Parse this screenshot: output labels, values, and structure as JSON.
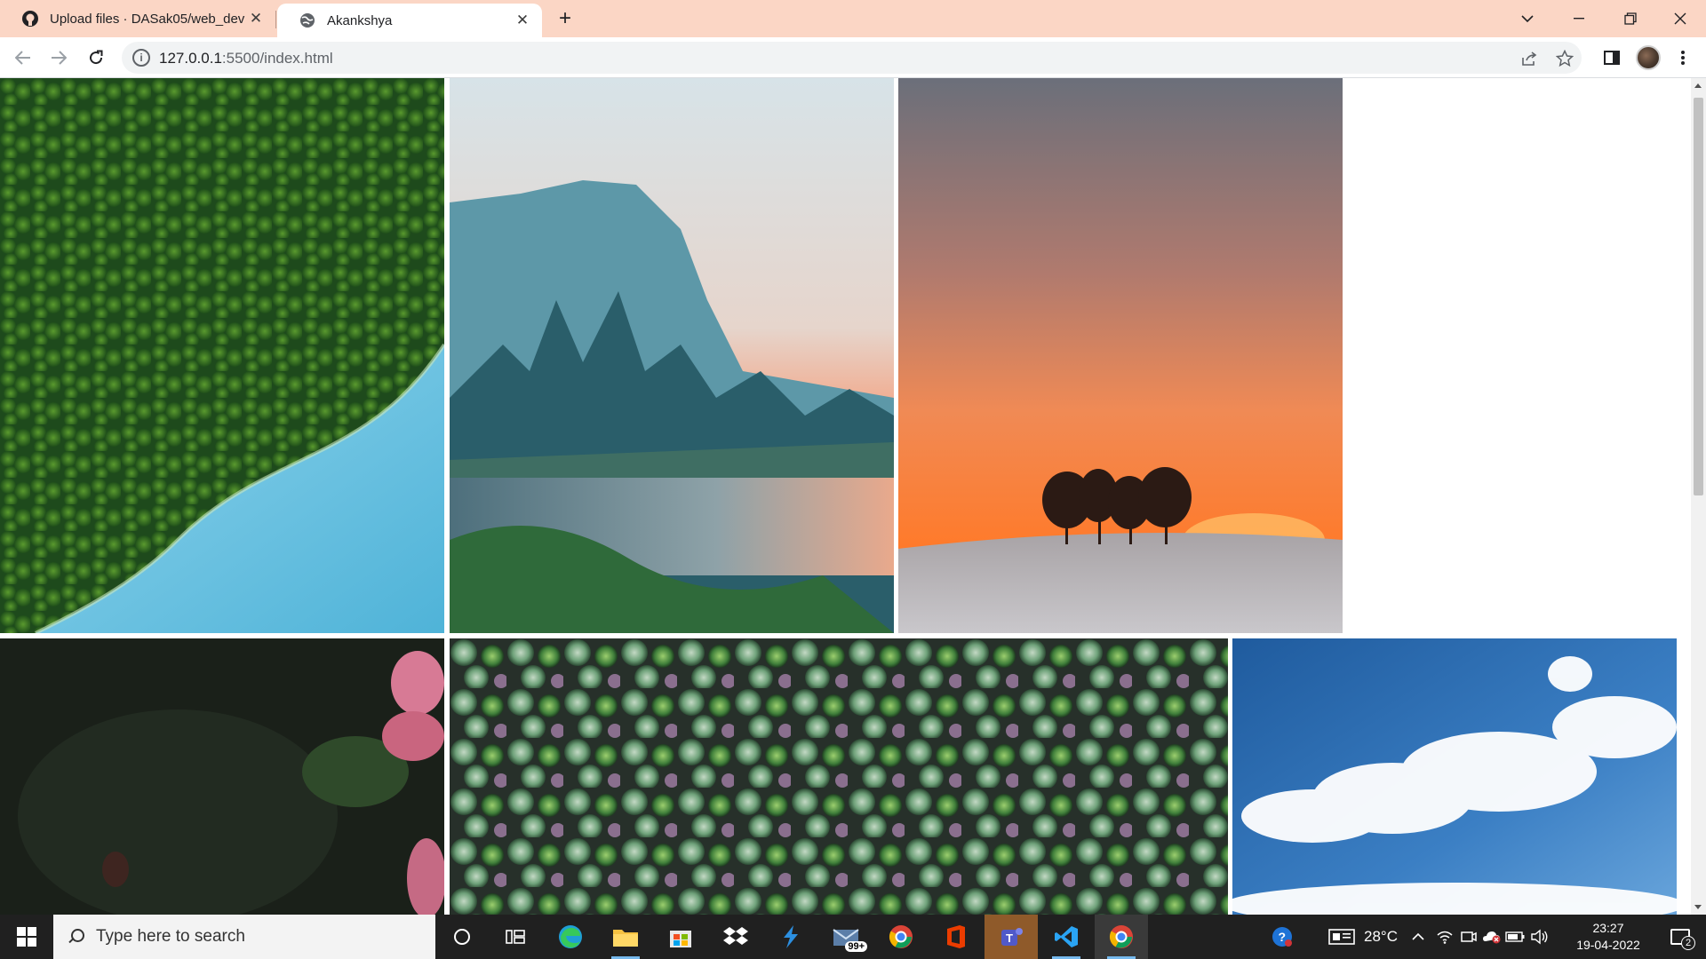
{
  "browser": {
    "tabs": [
      {
        "title": "Upload files · DASak05/web_dev",
        "icon": "github-icon",
        "active": false
      },
      {
        "title": "Akankshya",
        "icon": "globe-icon",
        "active": true
      }
    ],
    "new_tab_label": "+",
    "address": {
      "host": "127.0.0.1",
      "rest": ":5500/index.html"
    }
  },
  "gallery": {
    "images": [
      {
        "name": "aerial-forest-river",
        "description": "Aerial forest meeting turquoise river"
      },
      {
        "name": "misty-mountain-river",
        "description": "Misty mountain valley with pines and river"
      },
      {
        "name": "sunset-trees-snow",
        "description": "Orange sunset with trees on snowy field"
      },
      {
        "name": "pink-flower-dark",
        "description": "Pink roses on dark foliage"
      },
      {
        "name": "succulents-grid",
        "description": "Rows of green succulents"
      },
      {
        "name": "blue-sky-clouds",
        "description": "Blue sky with white clouds"
      }
    ]
  },
  "taskbar": {
    "search_placeholder": "Type here to search",
    "mail_badge": "99+",
    "weather": "28°C",
    "time": "23:27",
    "date": "19-04-2022",
    "notifications": "2",
    "colors": {
      "bg": "#202020",
      "accent": "#76b9ed"
    }
  }
}
